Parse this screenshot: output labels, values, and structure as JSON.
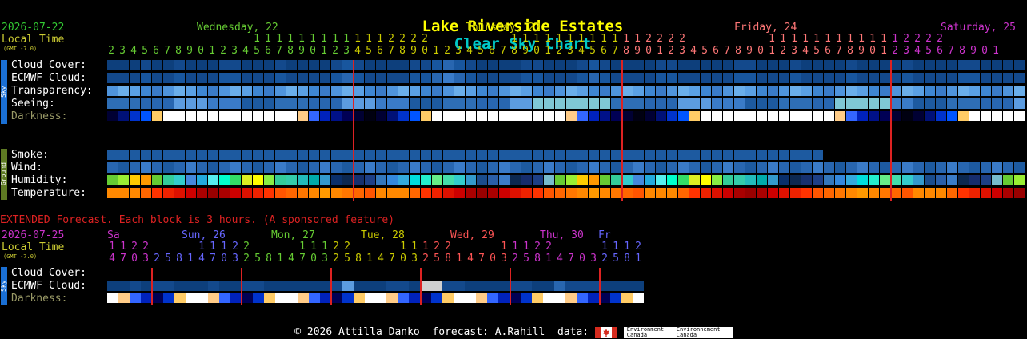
{
  "title": {
    "location": "Lake Riverside Estates",
    "chart": "Clear Sky Chart"
  },
  "colors": {
    "title_location": "#ffff00",
    "title_chart": "#00c8c8",
    "date": "#33cc33",
    "local": "#cccc33",
    "wed": "#66cc33",
    "thu": "#cccc00",
    "fri": "#ff7777",
    "sat": "#cc33cc",
    "sun": "#6666ff",
    "mon": "#66cc33",
    "tue": "#cccc00",
    "sep": "#dd2222"
  },
  "header": {
    "date": "2026-07-22",
    "local_time": "Local Time",
    "gmt": "(GMT -7.0)",
    "days": [
      {
        "label": "Wednesday, 22"
      },
      {
        "label": "Thursday, 23"
      },
      {
        "label": "Friday, 24"
      },
      {
        "label": "Saturday, 25"
      }
    ]
  },
  "hours": "23456789012345678901234567890123456789012345678901234567890123456789012345678901",
  "tens": "             1111111111112222       1111111111112222       1111111111112222      11",
  "sections": {
    "sky_label": "Sky",
    "ground_label": "Ground",
    "sky_rows": [
      "Cloud Cover:",
      "ECMWF Cloud:",
      "Transparency:",
      "Seeing:",
      "Darkness:"
    ],
    "ground_rows": [
      "Smoke:",
      "Wind:",
      "Humidity:",
      "Temperature:"
    ]
  },
  "extended": {
    "notice": "EXTENDED Forecast. Each block is 3 hours. (A sponsored feature)",
    "date": "2026-07-25",
    "local_time": "Local Time",
    "gmt": "(GMT -7.0)",
    "days": [
      "Sa",
      "Sun, 26",
      "Mon, 27",
      "Tue, 28",
      "Wed, 29",
      "Thu, 30",
      "Fr"
    ],
    "tens": "1122    11122    11122    11122    11122    11122    1",
    "hours": "470325814703258147032581470325814703258147032581",
    "rows": [
      "Cloud Cover:",
      "ECMWF Cloud:",
      "Darkness:"
    ]
  },
  "footer": {
    "copyright": "© 2026 Attilla Danko",
    "forecast": "forecast: A.Rahill",
    "data": "data:",
    "env1": "Environment Canada",
    "env2": "Environnement Canada"
  }
}
